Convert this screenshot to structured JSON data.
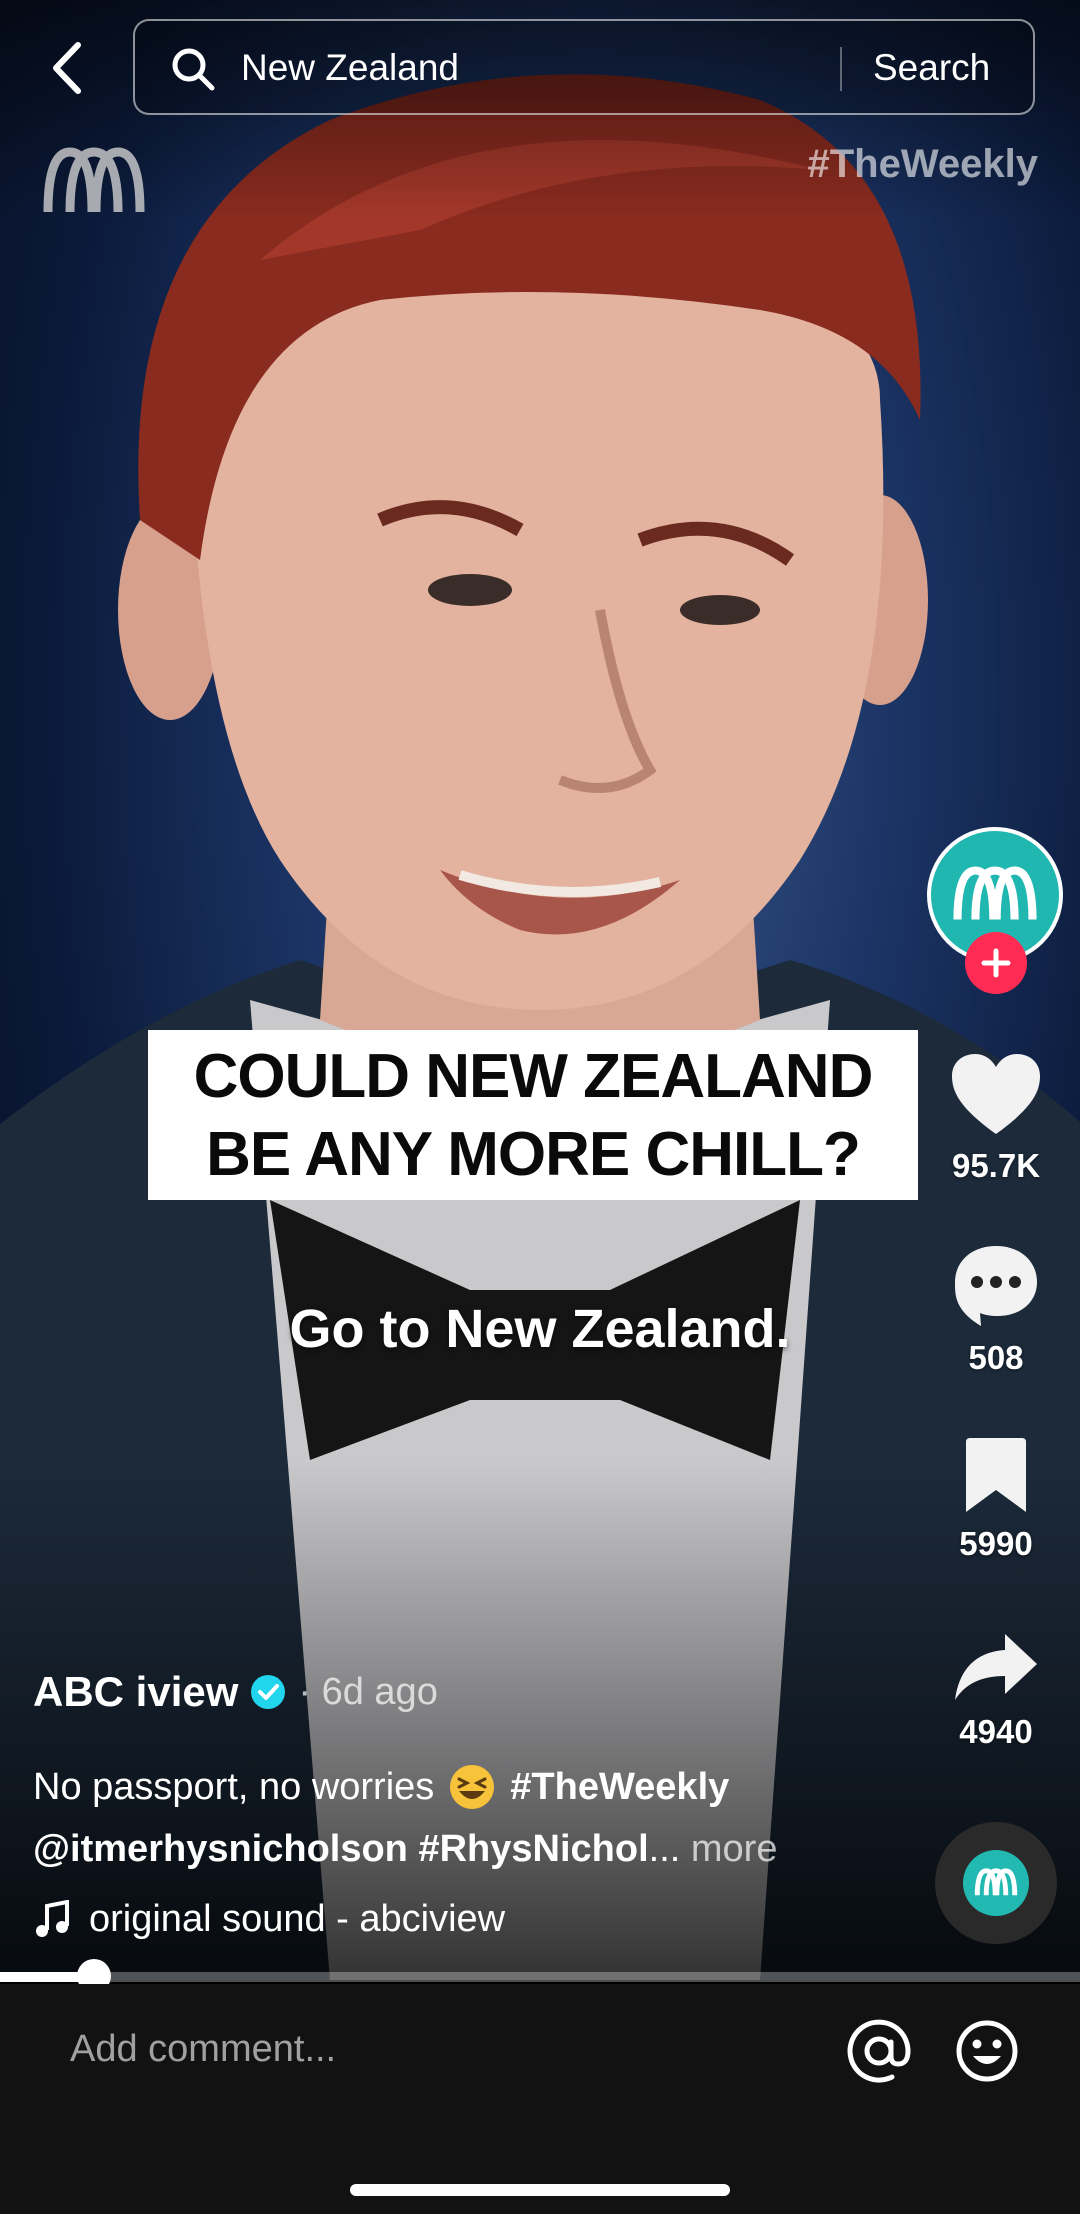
{
  "search": {
    "query": "New Zealand",
    "button_label": "Search"
  },
  "video": {
    "watermark_hashtag": "#TheWeekly",
    "caption_line1": "COULD NEW ZEALAND",
    "caption_line2": "BE ANY MORE CHILL?",
    "subtitle": "Go to New Zealand."
  },
  "actions": {
    "likes": "95.7K",
    "comments": "508",
    "saves": "5990",
    "shares": "4940"
  },
  "post": {
    "author": "ABC iview",
    "time": "· 6d ago",
    "desc_text": "No passport, no worries",
    "desc_hashtag1": "#TheWeekly",
    "desc_mention": "@itmerhysnicholson",
    "desc_hashtag2": "#RhysNichol",
    "desc_ellipsis": "...",
    "more_label": "more",
    "sound": "original sound - abciview"
  },
  "progress": {
    "fraction": 0.087
  },
  "comment": {
    "placeholder": "Add comment..."
  },
  "colors": {
    "accent": "#fe2c55",
    "abc_teal": "#20b7b0",
    "verified": "#20d5ec"
  },
  "icons": [
    "back-icon",
    "search-icon",
    "abc-logo",
    "heart-icon",
    "comment-icon",
    "bookmark-icon",
    "share-icon",
    "verified-icon",
    "music-note-icon",
    "mention-icon",
    "emoji-icon"
  ]
}
